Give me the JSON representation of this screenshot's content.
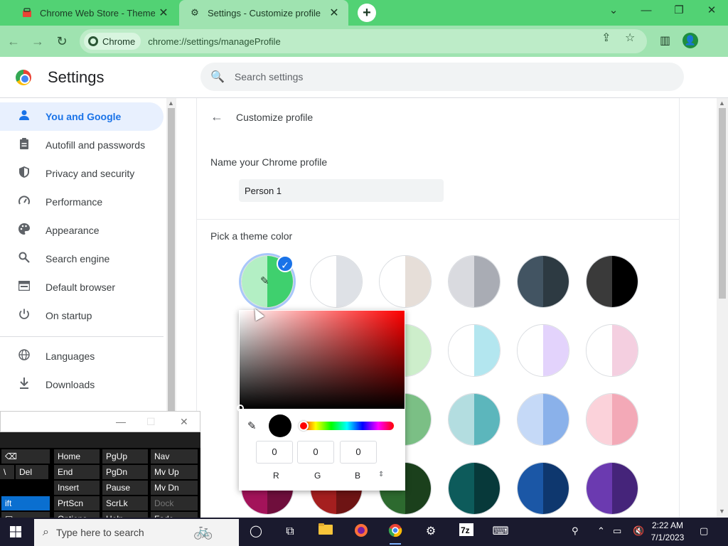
{
  "browser": {
    "tabs": [
      {
        "title": "Chrome Web Store - Themes",
        "favicon": "webstore-icon",
        "close": "✕"
      },
      {
        "title": "Settings - Customize profile",
        "favicon": "gear-icon",
        "close": "✕"
      }
    ],
    "new_tab": "+",
    "window_controls": {
      "tab_search": "⌄",
      "minimize": "—",
      "restore": "❐",
      "close": "✕"
    },
    "toolbar": {
      "back": "←",
      "forward": "→",
      "reload": "↻",
      "chip_label": "Chrome",
      "url": "chrome://settings/manageProfile"
    },
    "accent_color": "#52d274",
    "toolbar_color": "#9fe3b0"
  },
  "settings": {
    "title": "Settings",
    "search_placeholder": "Search settings",
    "nav": [
      {
        "label": "You and Google",
        "icon": "person-icon",
        "active": true
      },
      {
        "label": "Autofill and passwords",
        "icon": "clipboard-icon",
        "active": false
      },
      {
        "label": "Privacy and security",
        "icon": "shield-icon",
        "active": false
      },
      {
        "label": "Performance",
        "icon": "speedometer-icon",
        "active": false
      },
      {
        "label": "Appearance",
        "icon": "palette-icon",
        "active": false
      },
      {
        "label": "Search engine",
        "icon": "search-icon",
        "active": false
      },
      {
        "label": "Default browser",
        "icon": "browser-icon",
        "active": false
      },
      {
        "label": "On startup",
        "icon": "power-icon",
        "active": false
      },
      {
        "label": "Languages",
        "icon": "globe-icon",
        "active": false
      },
      {
        "label": "Downloads",
        "icon": "download-icon",
        "active": false
      }
    ],
    "page": {
      "title": "Customize profile",
      "name_label": "Name your Chrome profile",
      "name_value": "Person 1",
      "theme_label": "Pick a theme color"
    },
    "swatches": [
      {
        "left": "#b3efc4",
        "right": "#3fd06e",
        "selected": true
      },
      {
        "left": "#ffffff",
        "right": "#dee1e6",
        "selected": false
      },
      {
        "left": "#ffffff",
        "right": "#e6ded8",
        "selected": false
      },
      {
        "left": "#d9dadf",
        "right": "#a9acb4",
        "selected": false
      },
      {
        "left": "#425462",
        "right": "#2d3a42",
        "selected": false
      },
      {
        "left": "#3a3a3a",
        "right": "#000000",
        "selected": false
      },
      {
        "left": "#ffffff",
        "right": "#cdeecb",
        "selected": false
      },
      {
        "left": "#ffffff",
        "right": "#cdeecb",
        "selected": false
      },
      {
        "left": "#ffffff",
        "right": "#b3e6ef",
        "selected": false
      },
      {
        "left": "#ffffff",
        "right": "#e3d3fc",
        "selected": false
      },
      {
        "left": "#ffffff",
        "right": "#f4cfe0",
        "selected": false
      },
      {
        "left": "#b8e3c4",
        "right": "#7bbf85",
        "selected": false
      },
      {
        "left": "#b8e3c4",
        "right": "#7bbf85",
        "selected": false
      },
      {
        "left": "#b3dde0",
        "right": "#5cb6bc",
        "selected": false
      },
      {
        "left": "#c5d9f7",
        "right": "#8ab1ea",
        "selected": false
      },
      {
        "left": "#fbd2da",
        "right": "#f3a9b7",
        "selected": false
      },
      {
        "left": "#a3135a",
        "right": "#6f0e3c",
        "selected": false
      },
      {
        "left": "#a51f1f",
        "right": "#6e1414",
        "selected": false
      },
      {
        "left": "#2d6a2f",
        "right": "#1b401c",
        "selected": false
      },
      {
        "left": "#0d5b5b",
        "right": "#07393a",
        "selected": false
      },
      {
        "left": "#1b57a6",
        "right": "#0e376e",
        "selected": false
      },
      {
        "left": "#6b3ab0",
        "right": "#45247a",
        "selected": false
      }
    ],
    "color_picker": {
      "r": "0",
      "g": "0",
      "b": "0",
      "r_label": "R",
      "g_label": "G",
      "b_label": "B",
      "format_toggle": "⇕",
      "selected_color": "#000000"
    }
  },
  "keyboard": {
    "keys": [
      {
        "label": "⌫",
        "col": 0,
        "row": 0
      },
      {
        "label": "Home",
        "col": 1,
        "row": 0
      },
      {
        "label": "PgUp",
        "col": 2,
        "row": 0
      },
      {
        "label": "Nav",
        "col": 3,
        "row": 0
      },
      {
        "label": "\\",
        "col": -1,
        "row": 1
      },
      {
        "label": "Del",
        "col": 0,
        "row": 1
      },
      {
        "label": "End",
        "col": 1,
        "row": 1
      },
      {
        "label": "PgDn",
        "col": 2,
        "row": 1
      },
      {
        "label": "Mv Up",
        "col": 3,
        "row": 1
      },
      {
        "label": "Insert",
        "col": 1,
        "row": 2
      },
      {
        "label": "Pause",
        "col": 2,
        "row": 2
      },
      {
        "label": "Mv Dn",
        "col": 3,
        "row": 2
      },
      {
        "label": "ift",
        "col": 0,
        "row": 3,
        "blue": true
      },
      {
        "label": "PrtScn",
        "col": 1,
        "row": 3
      },
      {
        "label": "ScrLk",
        "col": 2,
        "row": 3
      },
      {
        "label": "Dock",
        "col": 3,
        "row": 3,
        "dim": true
      },
      {
        "label": "▤",
        "col": 0,
        "row": 4
      },
      {
        "label": "Options",
        "col": 1,
        "row": 4
      },
      {
        "label": "Help",
        "col": 2,
        "row": 4
      },
      {
        "label": "Fade",
        "col": 3,
        "row": 4
      }
    ]
  },
  "taskbar": {
    "search_placeholder": "Type here to search",
    "time": "2:22 AM",
    "date": "7/1/2023"
  }
}
